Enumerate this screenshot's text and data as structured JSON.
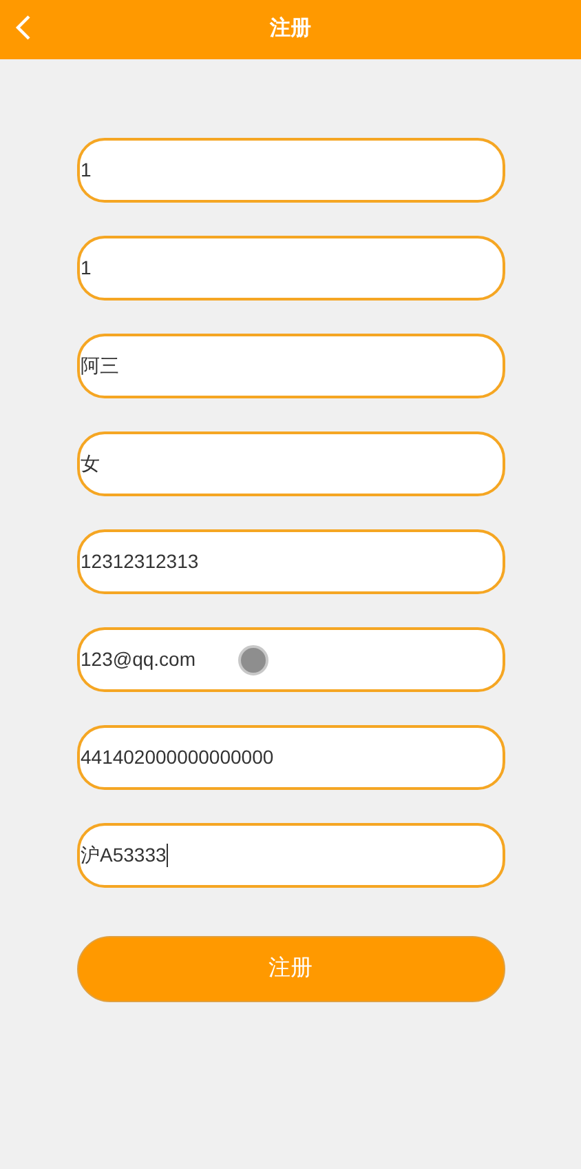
{
  "header": {
    "title": "注册"
  },
  "fields": [
    {
      "value": "1",
      "focused": false
    },
    {
      "value": "1",
      "focused": false
    },
    {
      "value": "阿三",
      "focused": false
    },
    {
      "value": "女",
      "focused": false
    },
    {
      "value": "12312312313",
      "focused": false
    },
    {
      "value": "123@qq.com",
      "focused": false,
      "touch": true
    },
    {
      "value": "441402000000000000",
      "focused": false
    },
    {
      "value": "沪A53333",
      "focused": true
    }
  ],
  "submit": {
    "label": "注册"
  }
}
